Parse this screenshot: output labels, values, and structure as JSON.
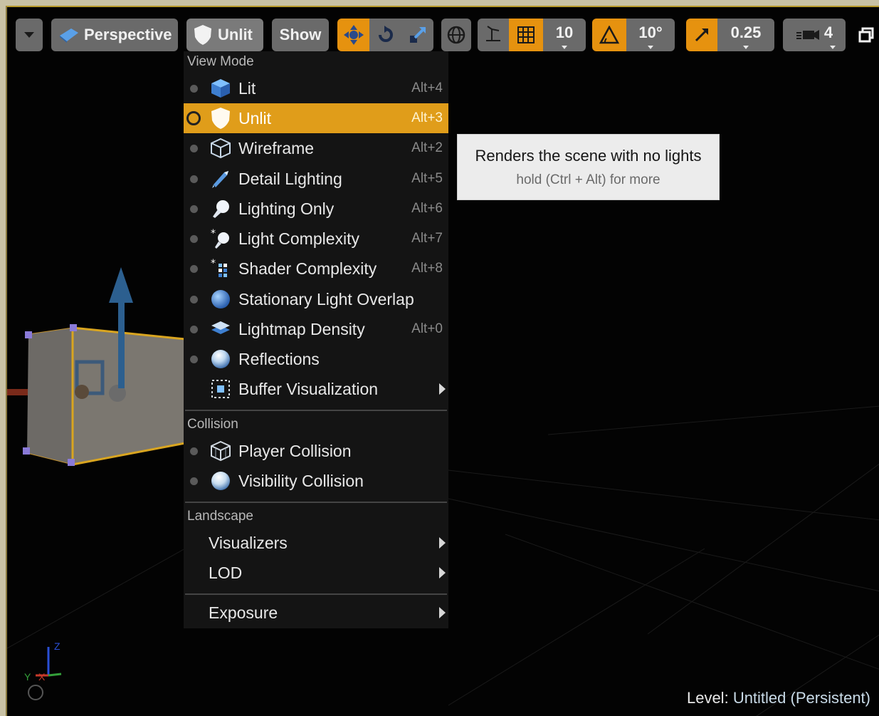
{
  "toolbar": {
    "perspective_label": "Perspective",
    "unlit_label": "Unlit",
    "show_label": "Show",
    "grid_snap_value": "10",
    "rotation_snap_value": "10°",
    "scale_snap_value": "0.25",
    "camera_speed_value": "4"
  },
  "menu": {
    "view_mode_header": "View Mode",
    "items": [
      {
        "label": "Lit",
        "shortcut": "Alt+4",
        "icon": "lit-cube-icon"
      },
      {
        "label": "Unlit",
        "shortcut": "Alt+3",
        "icon": "unlit-shield-icon",
        "selected": true
      },
      {
        "label": "Wireframe",
        "shortcut": "Alt+2",
        "icon": "wireframe-cube-icon"
      },
      {
        "label": "Detail Lighting",
        "shortcut": "Alt+5",
        "icon": "brush-icon"
      },
      {
        "label": "Lighting Only",
        "shortcut": "Alt+6",
        "icon": "lighting-only-icon"
      },
      {
        "label": "Light Complexity",
        "shortcut": "Alt+7",
        "icon": "light-complexity-icon"
      },
      {
        "label": "Shader Complexity",
        "shortcut": "Alt+8",
        "icon": "shader-complexity-icon"
      },
      {
        "label": "Stationary Light Overlap",
        "shortcut": "",
        "icon": "sphere-icon"
      },
      {
        "label": "Lightmap Density",
        "shortcut": "Alt+0",
        "icon": "lightmap-layers-icon"
      },
      {
        "label": "Reflections",
        "shortcut": "",
        "icon": "reflection-sphere-icon"
      },
      {
        "label": "Buffer Visualization",
        "shortcut": "",
        "icon": "buffer-grid-icon",
        "submenu": true
      }
    ],
    "collision_header": "Collision",
    "collision_items": [
      {
        "label": "Player Collision",
        "icon": "collision-cube-icon"
      },
      {
        "label": "Visibility Collision",
        "icon": "visibility-sphere-icon"
      }
    ],
    "landscape_header": "Landscape",
    "landscape_items": [
      {
        "label": "Visualizers"
      },
      {
        "label": "LOD"
      }
    ],
    "exposure_label": "Exposure"
  },
  "tooltip": {
    "title": "Renders the scene with no lights",
    "hint": "hold (Ctrl + Alt) for more"
  },
  "status": {
    "level_prefix": "Level:",
    "level_name": "Untitled (Persistent)"
  },
  "axis": {
    "x_label": "X",
    "y_label": "Y",
    "z_label": "Z"
  },
  "colors": {
    "accent": "#e09d1a",
    "menu_bg": "#141414",
    "toolbar_button": "#6a6a6a"
  }
}
